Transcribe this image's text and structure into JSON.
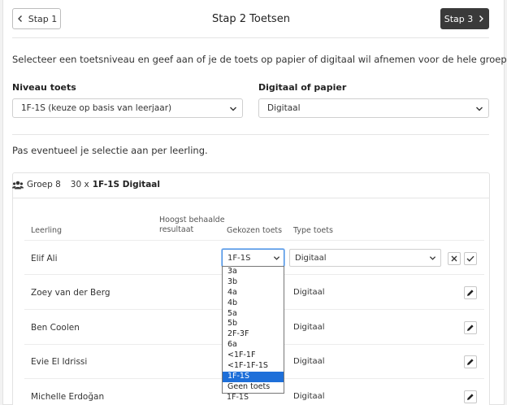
{
  "header": {
    "prev_label": "Stap 1",
    "title": "Stap 2 Toetsen",
    "next_label": "Stap 3"
  },
  "intro": "Selecteer een toetsniveau en geef aan of je de toets op papier of digitaal wil afnemen voor de hele groep.",
  "niveau": {
    "label": "Niveau toets",
    "value": "1F-1S (keuze op basis van leerjaar)"
  },
  "modus": {
    "label": "Digitaal of papier",
    "value": "Digitaal"
  },
  "sub": "Pas eventueel je selectie aan per leerling.",
  "panel": {
    "group": "Groep 8",
    "count": "30 x",
    "selection": "1F-1S Digitaal"
  },
  "columns": {
    "leerling": "Leerling",
    "hoogst": "Hoogst behaalde",
    "resultaat": "resultaat",
    "gekozen": "Gekozen toets",
    "type": "Type toets"
  },
  "editing_row": {
    "name": "Elif Ali",
    "toets": "1F-1S",
    "type": "Digitaal"
  },
  "rows": [
    {
      "name": "Zoey van der Berg",
      "type": "Digitaal"
    },
    {
      "name": "Ben Coolen",
      "type": "Digitaal"
    },
    {
      "name": "Evie El Idrissi",
      "type": "Digitaal"
    },
    {
      "name": "Michelle Erdoğan",
      "toets": "1F-1S",
      "type": "Digitaal"
    }
  ],
  "dropdown_options": [
    "3a",
    "3b",
    "4a",
    "4b",
    "5a",
    "5b",
    "2F-3F",
    "6a",
    "<1F-1F",
    "<1F-1F-1S",
    "1F-1S",
    "Geen toets"
  ],
  "dropdown_selected_index": 10,
  "colors": {
    "accent_dark": "#3a3a3a",
    "selected_option": "#1e6fd9",
    "focus_border": "#4a90e2"
  }
}
